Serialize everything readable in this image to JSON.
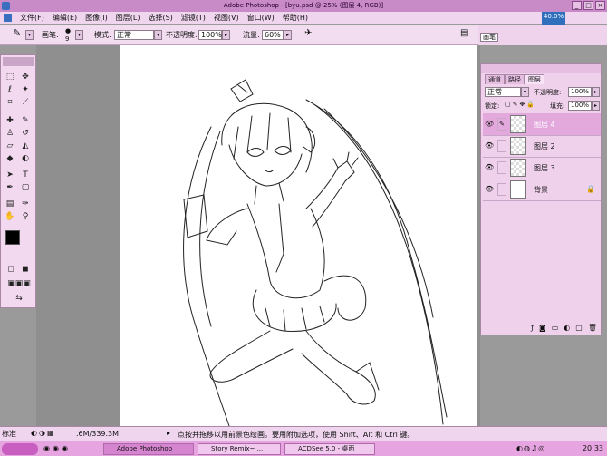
{
  "window": {
    "title": "Adobe Photoshop - [byu.psd @ 25% (图层 4, RGB)]"
  },
  "menu": [
    "文件(F)",
    "编辑(E)",
    "图像(I)",
    "图层(L)",
    "选择(S)",
    "滤镜(T)",
    "视图(V)",
    "窗口(W)",
    "帮助(H)"
  ],
  "options": {
    "brush_label": "画笔:",
    "brush_size": "9",
    "mode_label": "模式:",
    "mode_value": "正常",
    "opacity_label": "不透明度:",
    "opacity_value": "100%",
    "flow_label": "流量:",
    "flow_value": "60%"
  },
  "navigator": {
    "zoom": "40.0%"
  },
  "palette_well": {
    "brush_tab": "画笔"
  },
  "layers_panel": {
    "tabs": [
      "通道",
      "路径",
      "图层"
    ],
    "blend_mode": "正常",
    "opacity_label": "不透明度:",
    "opacity_value": "100%",
    "lock_label": "锁定:",
    "fill_label": "填充:",
    "fill_value": "100%",
    "layers": [
      {
        "name": "图层 4",
        "selected": true
      },
      {
        "name": "图层 2",
        "selected": false
      },
      {
        "name": "图层 3",
        "selected": false
      },
      {
        "name": "背景",
        "selected": false,
        "locked": true
      }
    ]
  },
  "toolbox": {
    "mode_label": "标准"
  },
  "status": {
    "doc_size": ".6M/339.3M",
    "hint": "点按并拖移以用前景色绘画。要用附加选项，使用 Shift、Alt 和 Ctrl 键。"
  },
  "taskbar": {
    "tasks": [
      "Adobe Photoshop",
      "Story Remix~ ...",
      "ACDSee 5.0 - 桌面"
    ],
    "clock": "20:33"
  }
}
